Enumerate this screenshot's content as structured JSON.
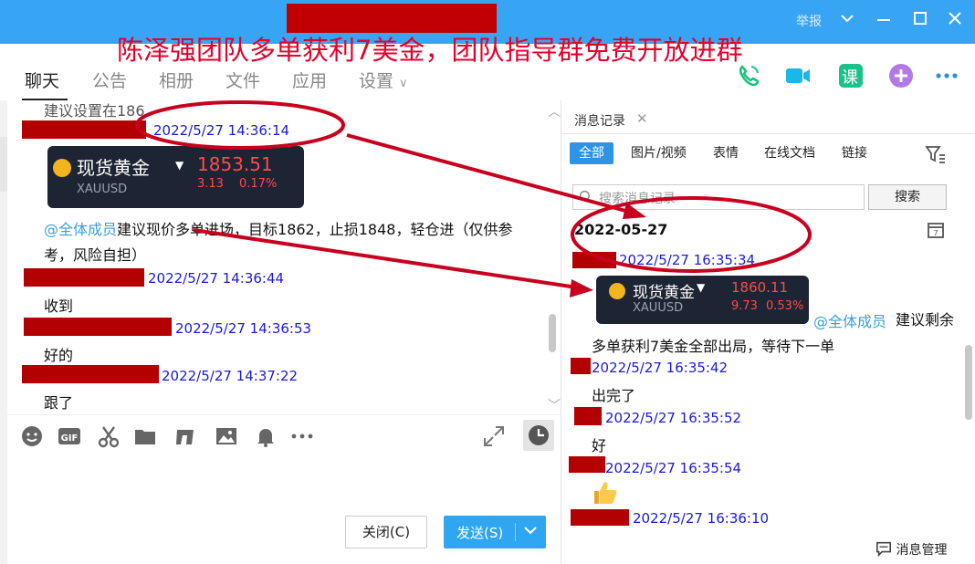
{
  "promo_text": "陈泽强团队多单获利7美金，团队指导群免费开放进群",
  "titlebar": {
    "report_label": "举报"
  },
  "tabs": [
    {
      "label": "聊天"
    },
    {
      "label": "公告"
    },
    {
      "label": "相册"
    },
    {
      "label": "文件"
    },
    {
      "label": "应用"
    },
    {
      "label": "设置"
    }
  ],
  "course_icon_label": "课",
  "chat": {
    "partial_top_text": "建议设置在186",
    "messages": [
      {
        "time": "2022/5/27 14:36:14"
      },
      {
        "text": ""
      },
      {
        "time": "2022/5/27 14:36:44"
      },
      {
        "time": "2022/5/27 14:36:53"
      },
      {
        "time": "2022/5/27 14:37:22"
      }
    ],
    "gold_card": {
      "title": "现货黄金",
      "price": "1853.51",
      "symbol": "XAUUSD",
      "change": "3.13",
      "pct": "0.17%"
    },
    "announce_mention": "@全体成员",
    "announce_line1": "建议现价多单进场，目标1862，止损1848，轻仓进（仅供参",
    "announce_line2": "考，风险自担）",
    "reply_1": "收到",
    "reply_2": "好的",
    "reply_3": "跟了"
  },
  "buttons": {
    "close": "关闭(C)",
    "send": "发送(S)"
  },
  "history": {
    "tab_label": "消息记录",
    "filters": [
      "全部",
      "图片/视频",
      "表情",
      "在线文档",
      "链接"
    ],
    "search_placeholder": "搜索消息记录",
    "search_button": "搜索",
    "date": "2022-05-27",
    "t1": "2022/5/27 16:35:34",
    "gold_card": {
      "title": "现货黄金",
      "price": "1860.11",
      "symbol": "XAUUSD",
      "change": "9.73",
      "pct": "0.53%"
    },
    "mention": "@全体成员",
    "mention_text": "建议剩余",
    "line2": "多单获利7美金全部出局，等待下一单",
    "t2": "2022/5/27 16:35:42",
    "r1": "出完了",
    "t3": "2022/5/27 16:35:52",
    "r2": "好",
    "t4": "2022/5/27 16:35:54",
    "t5": "2022/5/27 16:36:10",
    "footer": "消息管理"
  },
  "colors": {
    "titlebar": "#38a4f4",
    "redaction": "#b30000",
    "timestamp": "#1a1adc",
    "annotation": "#c8001e",
    "send": "#2fa6f2"
  }
}
